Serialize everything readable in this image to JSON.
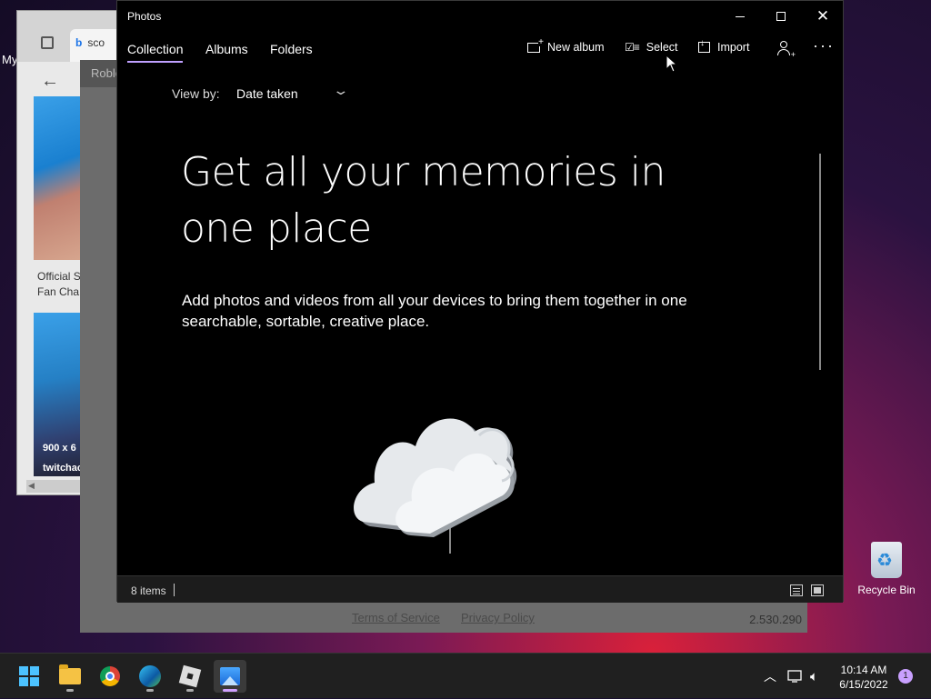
{
  "desktop": {
    "left_text": "My"
  },
  "edge_window": {
    "tab_label": "sco",
    "card1_caption_line1": "Official S",
    "card1_caption_line2": "Fan Cha",
    "card2_caption_line1": "900 x 6",
    "card2_caption_line2": "twitchac"
  },
  "roblox_window": {
    "tab_title": "Roblo",
    "footer_terms": "Terms of Service",
    "footer_privacy": "Privacy Policy",
    "footer_version": "2.530.290"
  },
  "photos": {
    "title": "Photos",
    "nav_tabs": [
      {
        "label": "Collection",
        "active": true
      },
      {
        "label": "Albums",
        "active": false
      },
      {
        "label": "Folders",
        "active": false
      }
    ],
    "commands": {
      "new_album": "New album",
      "select": "Select",
      "import": "Import"
    },
    "view_by_label": "View by:",
    "view_by_value": "Date taken",
    "headline": "Get all your memories in one place",
    "subtext": "Add photos and videos from all your devices to bring them together in one searchable, sortable, creative place.",
    "status_count": "8 items",
    "accent_color": "#c0a0ff"
  },
  "recycle_bin": {
    "label": "Recycle Bin"
  },
  "taskbar": {
    "apps": [
      "start-icon",
      "file-explorer-icon",
      "chrome-icon",
      "edge-icon",
      "roblox-icon",
      "photos-icon"
    ],
    "time": "10:14 AM",
    "date": "6/15/2022",
    "notification_count": "1"
  }
}
